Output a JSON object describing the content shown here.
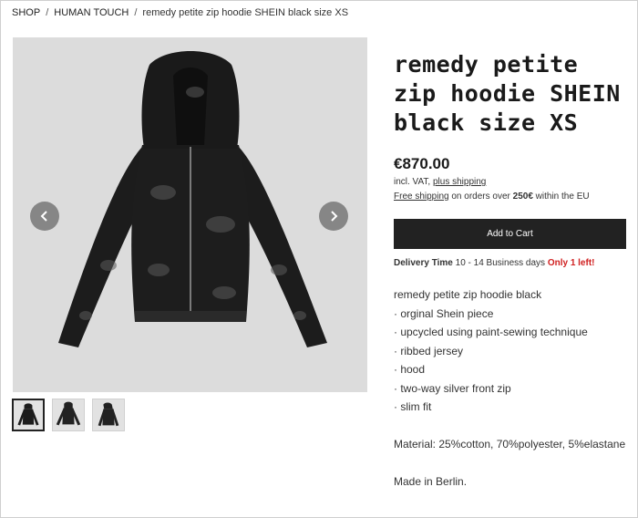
{
  "breadcrumb": {
    "items": [
      "SHOP",
      "HUMAN TOUCH"
    ],
    "current": "remedy petite zip hoodie SHEIN black size XS",
    "separator": "/"
  },
  "product": {
    "title": "remedy petite zip hoodie SHEIN black size XS",
    "price": "€870.00",
    "vat_prefix": "incl. VAT,",
    "vat_link": "plus shipping",
    "shipping_link": "Free shipping",
    "shipping_note": "on orders over",
    "shipping_threshold": "250€",
    "shipping_suffix": "within the EU",
    "add_to_cart": "Add to Cart",
    "delivery_label": "Delivery Time",
    "delivery_value": "10 - 14 Business days",
    "stock": "Only 1 left!",
    "description": {
      "intro": "remedy petite zip hoodie black",
      "bullets": [
        "· orginal Shein piece",
        "· upcycled using paint-sewing technique",
        "· ribbed jersey",
        "· hood",
        "· two-way silver front zip",
        "· slim fit"
      ],
      "material": "Material: 25%cotton, 70%polyester, 5%elastane",
      "origin": "Made in Berlin."
    }
  },
  "gallery": {
    "main_icon": "hoodie-photo",
    "prev_icon": "chevron-left-icon",
    "next_icon": "chevron-right-icon",
    "thumbnail_count": 3,
    "active_thumbnail": 1
  },
  "colors": {
    "button_bg": "#222222",
    "stock_red": "#d02020",
    "photo_bg": "#dcdcdc",
    "garment": "#1c1c1c"
  }
}
